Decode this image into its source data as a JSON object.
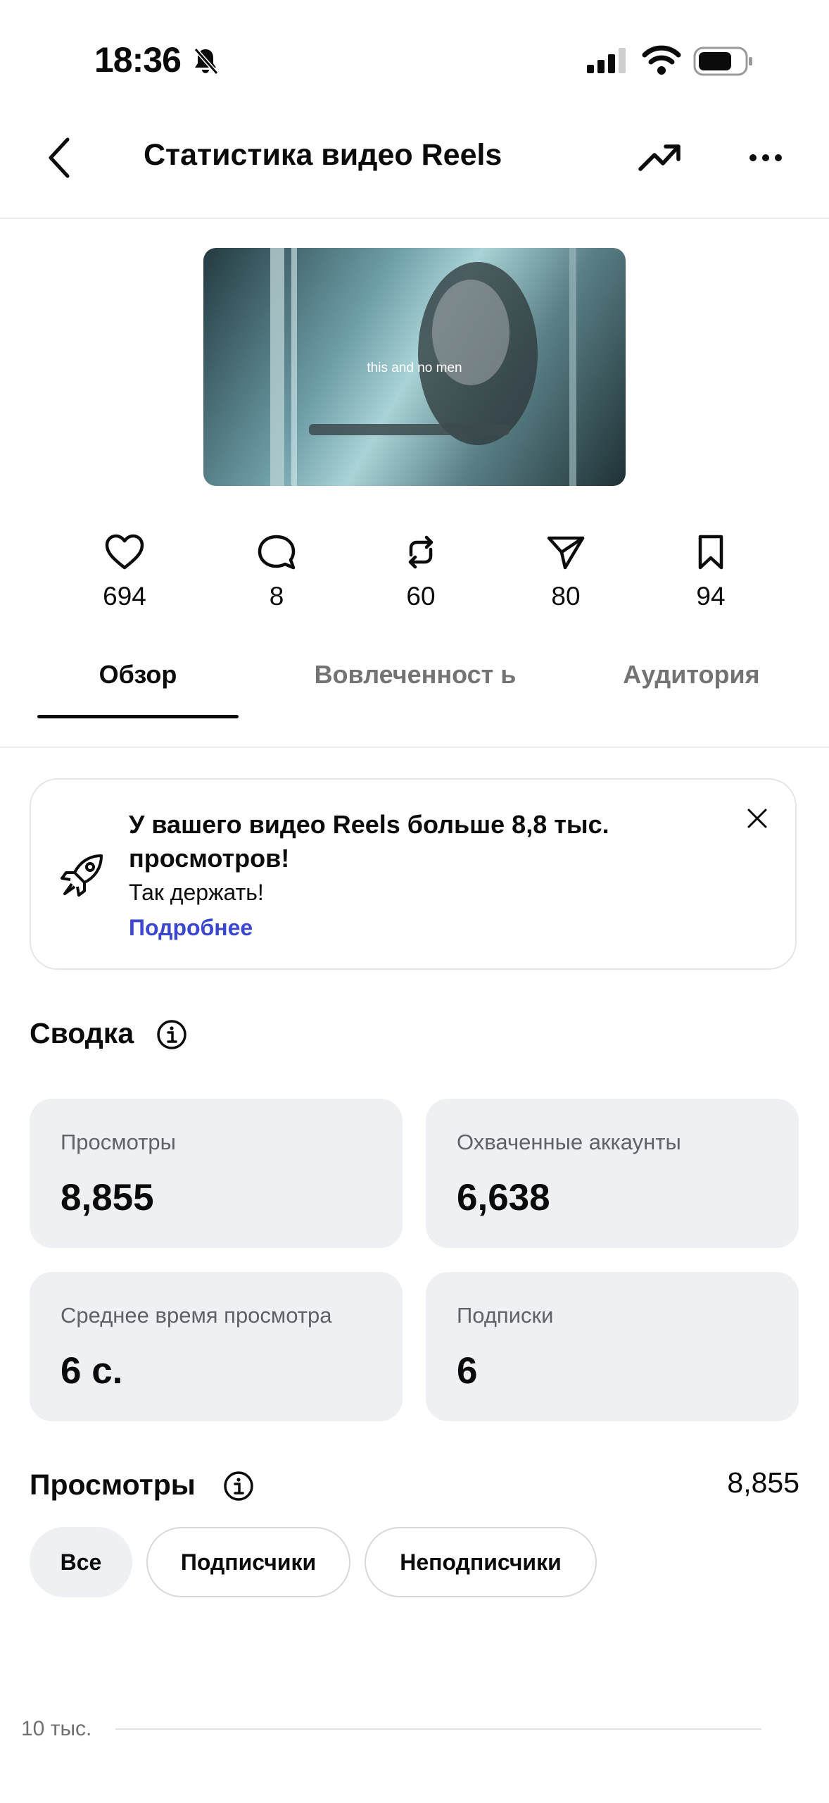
{
  "status_bar": {
    "time": "18:36"
  },
  "header": {
    "title": "Статистика видео Reels"
  },
  "thumbnail": {
    "caption": "this and no men"
  },
  "metrics": [
    {
      "icon": "heart-icon",
      "value": "694"
    },
    {
      "icon": "comment-icon",
      "value": "8"
    },
    {
      "icon": "repost-icon",
      "value": "60"
    },
    {
      "icon": "share-icon",
      "value": "80"
    },
    {
      "icon": "bookmark-icon",
      "value": "94"
    }
  ],
  "tabs": [
    {
      "label": "Обзор",
      "active": true
    },
    {
      "label": "Вовлеченност ь",
      "active": false
    },
    {
      "label": "Аудитория",
      "active": false
    }
  ],
  "banner": {
    "title": "У вашего видео Reels больше 8,8 тыс. просмотров!",
    "subtitle": "Так держать!",
    "link": "Подробнее"
  },
  "summary": {
    "title": "Сводка",
    "cards": [
      {
        "label": "Просмотры",
        "value": "8,855"
      },
      {
        "label": "Охваченные аккаунты",
        "value": "6,638"
      },
      {
        "label": "Среднее время просмотра",
        "value": "6 с."
      },
      {
        "label": "Подписки",
        "value": "6"
      }
    ]
  },
  "views": {
    "title": "Просмотры",
    "total": "8,855",
    "filters": [
      {
        "label": "Все",
        "active": true
      },
      {
        "label": "Подписчики",
        "active": false
      },
      {
        "label": "Неподписчики",
        "active": false
      }
    ],
    "axis_label": "10 тыс."
  },
  "colors": {
    "accent_link": "#3b46d1",
    "card_bg": "#eff0f4"
  }
}
